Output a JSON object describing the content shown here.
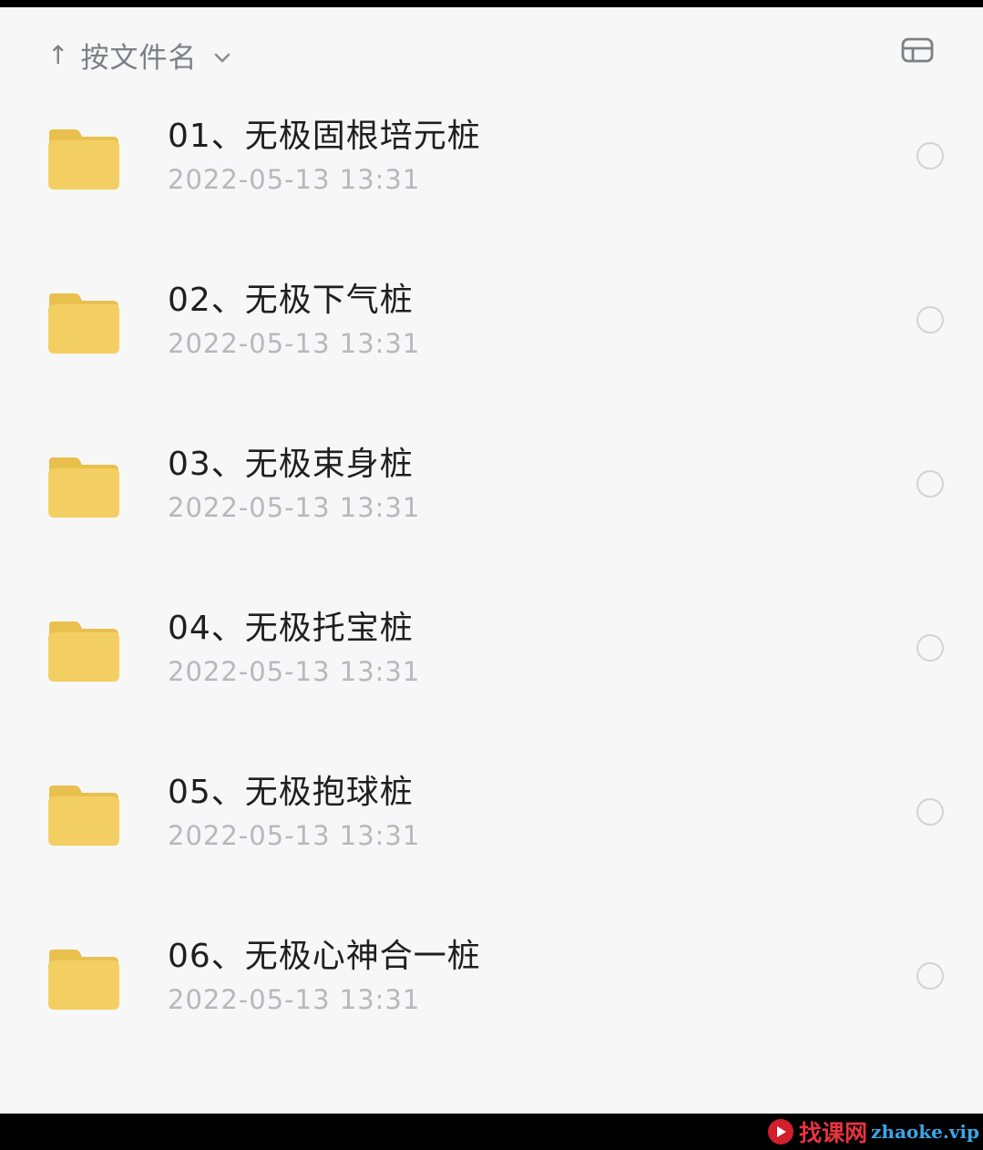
{
  "header": {
    "sort_arrow": "↑",
    "sort_label": "按文件名",
    "sort_chevron": "⌄",
    "view_toggle_icon": "list-view-icon"
  },
  "files": [
    {
      "name": "01、无极固根培元桩",
      "date": "2022-05-13 13:31",
      "icon": "folder-icon"
    },
    {
      "name": "02、无极下气桩",
      "date": "2022-05-13 13:31",
      "icon": "folder-icon"
    },
    {
      "name": "03、无极束身桩",
      "date": "2022-05-13 13:31",
      "icon": "folder-icon"
    },
    {
      "name": "04、无极托宝桩",
      "date": "2022-05-13 13:31",
      "icon": "folder-icon"
    },
    {
      "name": "05、无极抱球桩",
      "date": "2022-05-13 13:31",
      "icon": "folder-icon"
    },
    {
      "name": "06、无极心神合一桩",
      "date": "2022-05-13 13:31",
      "icon": "folder-icon"
    }
  ],
  "watermark": {
    "cn": "找课网",
    "en": "zhaoke.vip"
  },
  "colors": {
    "folder": "#f3cf63",
    "folder_tab": "#e9c04e",
    "background": "#f7f7f8",
    "title_text": "#1f1f21",
    "date_text": "#b7b8bd",
    "watermark_red": "#e8343f",
    "watermark_blue": "#3aa6e8"
  }
}
